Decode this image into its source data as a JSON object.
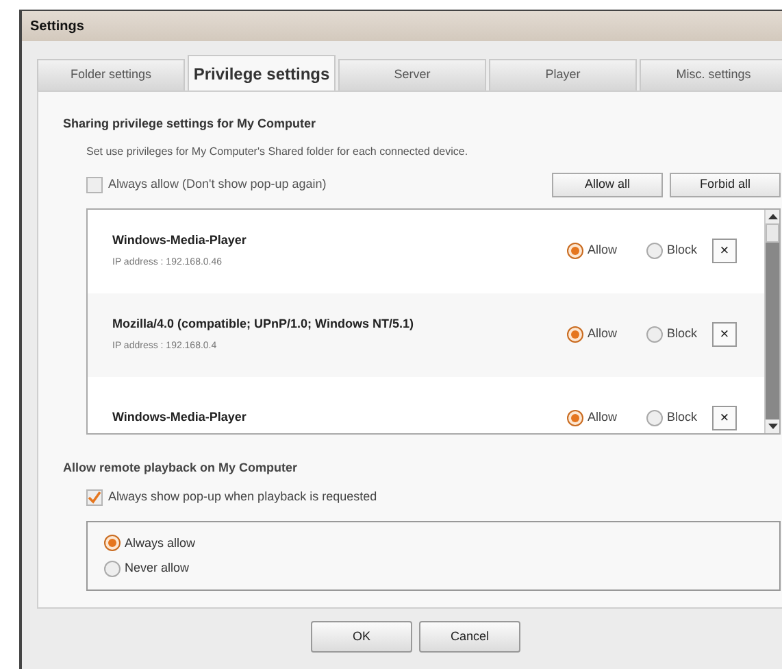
{
  "window": {
    "title": "Settings"
  },
  "tabs": [
    {
      "label": "Folder settings",
      "selected": false
    },
    {
      "label": "Privilege settings",
      "selected": true
    },
    {
      "label": "Server",
      "selected": false
    },
    {
      "label": "Player",
      "selected": false
    },
    {
      "label": "Misc. settings",
      "selected": false
    }
  ],
  "sharing": {
    "heading": "Sharing privilege settings for My Computer",
    "description": "Set use privileges for My Computer's Shared folder for each connected device.",
    "always_allow": {
      "label": "Always allow (Don't show pop-up again)",
      "checked": false
    },
    "buttons": [
      "Allow all",
      "Forbid all"
    ],
    "devices": [
      {
        "name": "Windows-Media-Player",
        "ip": "IP address : 192.168.0.46",
        "allow_label": "Allow",
        "block_label": "Block",
        "allowed": true,
        "remove": "×"
      },
      {
        "name": "Mozilla/4.0 (compatible; UPnP/1.0; Windows NT/5.1)",
        "ip": "IP address : 192.168.0.4",
        "allow_label": "Allow",
        "block_label": "Block",
        "allowed": true,
        "remove": "×"
      },
      {
        "name": "Windows-Media-Player",
        "allow_label": "Allow",
        "block_label": "Block",
        "allowed": true,
        "remove": "×"
      }
    ]
  },
  "remote": {
    "heading": "Allow remote playback on My Computer",
    "show_popup": {
      "label": "Always show pop-up when playback is requested",
      "checked": true
    },
    "options": [
      {
        "label": "Always allow",
        "selected": true
      },
      {
        "label": "Never allow",
        "selected": false
      }
    ]
  },
  "buttons": [
    "OK",
    "Cancel"
  ]
}
